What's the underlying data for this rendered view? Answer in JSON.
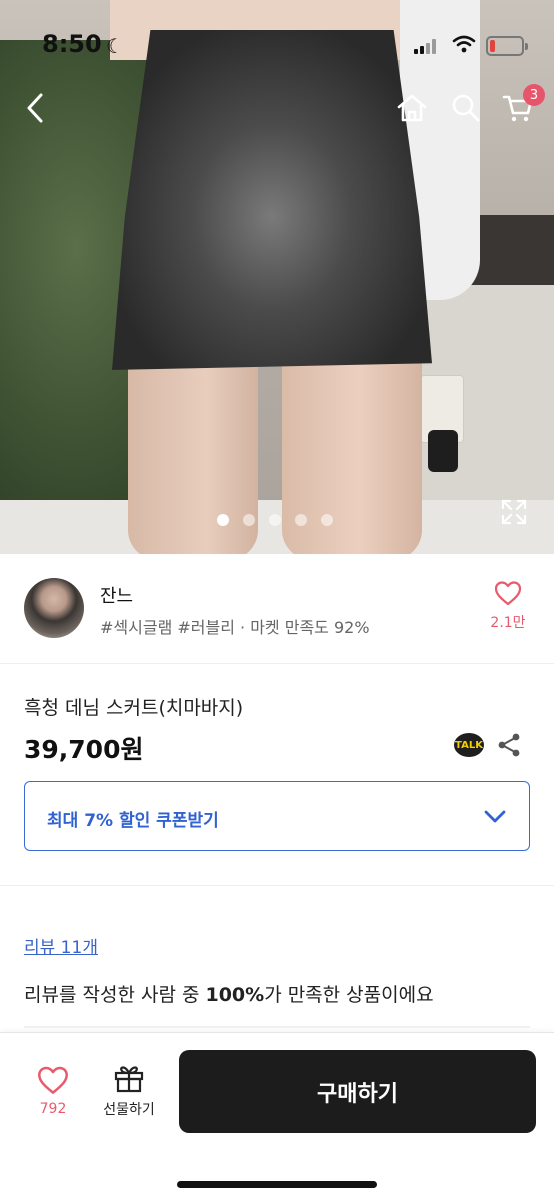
{
  "status_bar": {
    "time": "8:50",
    "battery_level": 0.15
  },
  "nav": {
    "back_icon": "chevron-left-icon",
    "home_icon": "home-icon",
    "search_icon": "search-icon",
    "cart_icon": "cart-icon",
    "cart_badge": "3"
  },
  "gallery": {
    "image_count": 5,
    "active_index": 0,
    "expand_icon": "expand-icon"
  },
  "seller": {
    "name": "잔느",
    "tags": "#섹시글램 #러블리 · 마켓 만족도 92%",
    "like_count": "2.1만"
  },
  "product": {
    "title": "흑청 데님 스커트(치마바지)",
    "price": "39,700원",
    "talk_label": "TALK"
  },
  "coupon": {
    "label": "최대 7% 할인 쿠폰받기"
  },
  "reviews": {
    "link": "리뷰 11개",
    "summary_prefix": "리뷰를 작성한 사람 중 ",
    "summary_bold": "100%",
    "summary_suffix": "가 만족한 상품이에요"
  },
  "bottom_bar": {
    "wish_count": "792",
    "gift_label": "선물하기",
    "buy_label": "구매하기"
  },
  "colors": {
    "accent_blue": "#3162d1",
    "heart_pink": "#e85b6c",
    "buy_button": "#1c1c1c",
    "badge": "#e8556b"
  }
}
